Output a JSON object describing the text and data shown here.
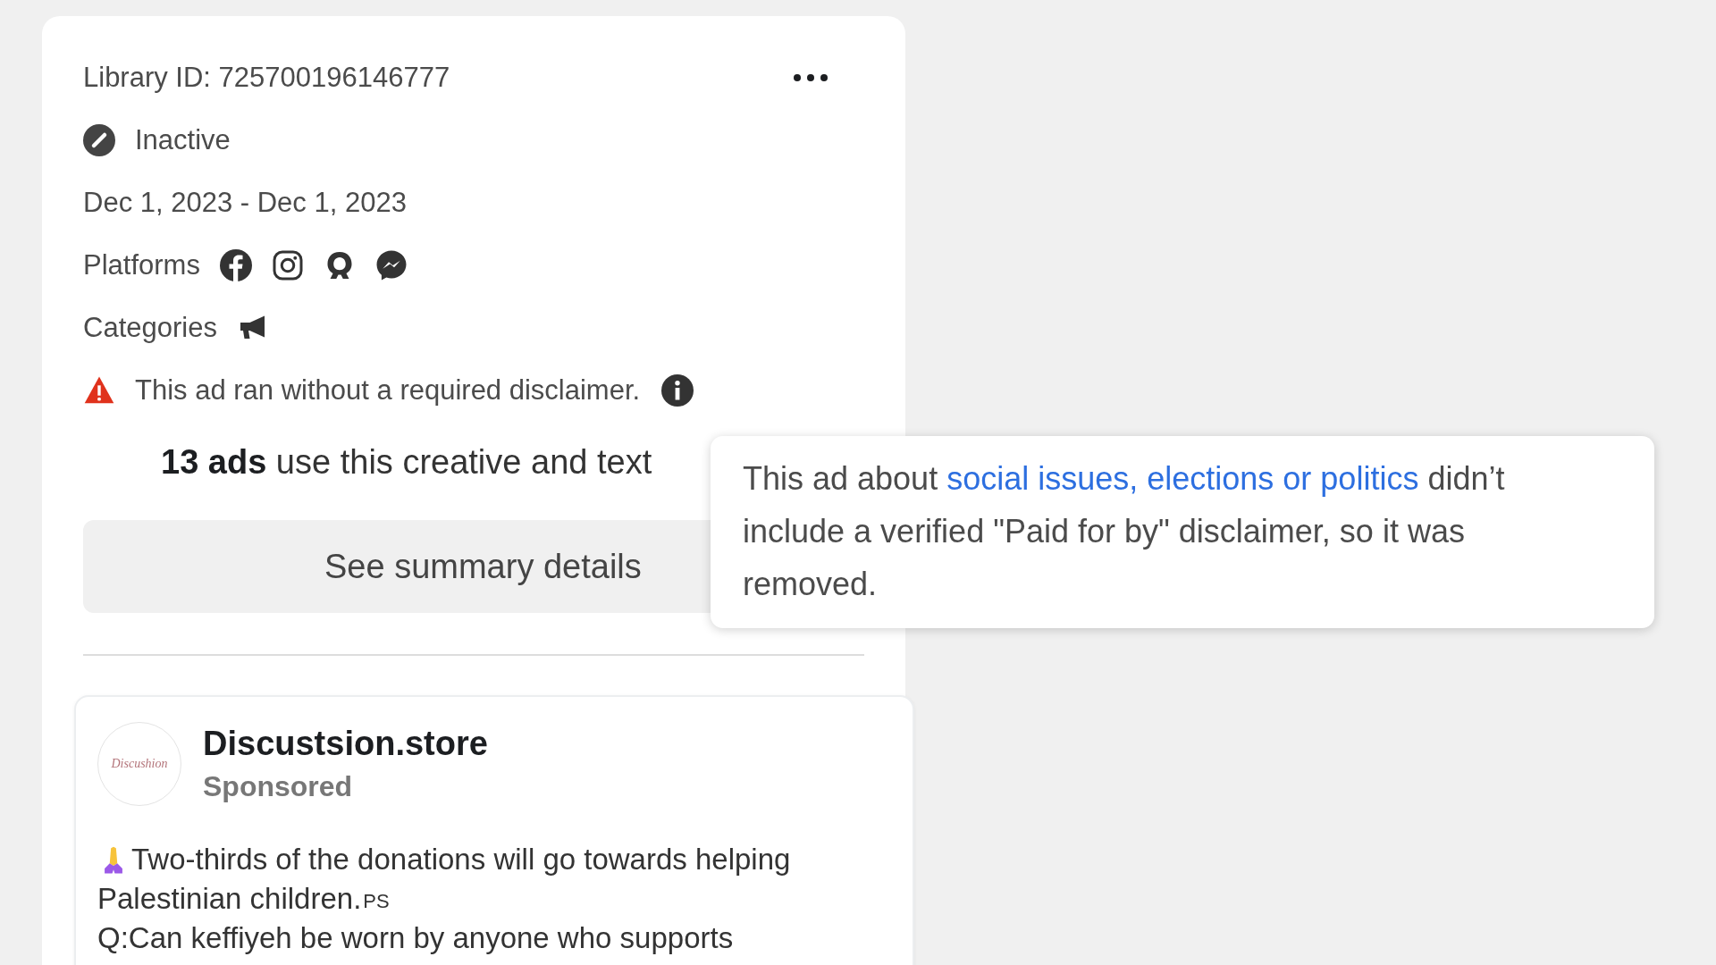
{
  "ad": {
    "library_id": "Library ID: 725700196146777",
    "status": "Inactive",
    "dates": "Dec 1, 2023 - Dec 1, 2023",
    "platforms_label": "Platforms",
    "categories_label": "Categories",
    "warning": "This ad ran without a required disclaimer.",
    "ads_count": "**13 ads** use this creative and text",
    "summary_button": "See summary details"
  },
  "tooltip": {
    "before": "This ad about ",
    "link": "social issues, elections or politics",
    "after": " didn’t include a verified \"Paid for by\" disclaimer, so it was removed."
  },
  "post": {
    "avatar_text": "Discushion",
    "page_name": "Discustsion.store",
    "sponsored": "Sponsored",
    "line_1": "Two-thirds of the donations will go towards helping",
    "line_2": "Palestinian children.",
    "flag": "PS",
    "line_3": "Q:Can keffiyeh be worn by anyone who supports"
  }
}
